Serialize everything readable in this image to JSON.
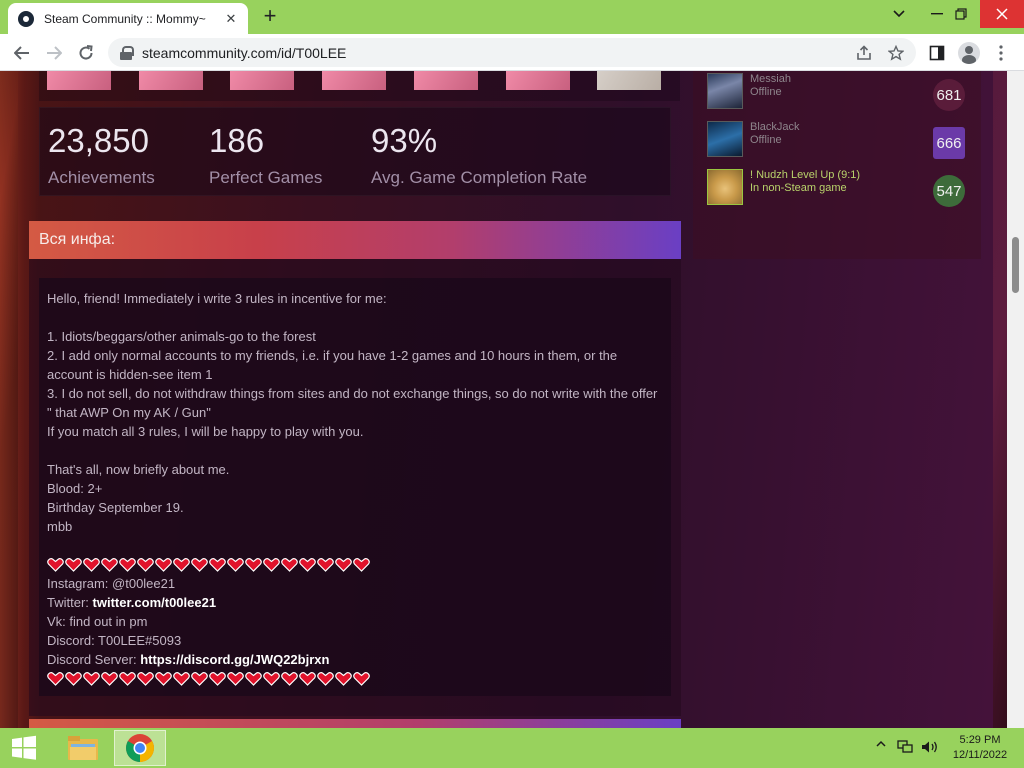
{
  "browser": {
    "tab_title": "Steam Community :: Mommy~",
    "url": "steamcommunity.com/id/T00LEE",
    "new_tab_label": "+",
    "tab_close": "✕"
  },
  "stats": [
    {
      "value": "23,850",
      "label": "Achievements"
    },
    {
      "value": "186",
      "label": "Perfect Games"
    },
    {
      "value": "93%",
      "label": "Avg. Game Completion Rate"
    }
  ],
  "info": {
    "header": "Вся инфа:",
    "lines": {
      "l1": "Hello, friend! Immediately i write 3 rules in incentive for me:",
      "l2": "1. Idiots/beggars/other animals-go to the forest",
      "l3": "2. I add only normal accounts to my friends, i.e. if you have 1-2 games and 10 hours in them, or the account is hidden-see item 1",
      "l4": "3. I do not sell, do not withdraw things from sites and do not exchange things, so do not write with the offer \" that AWP On my AK / Gun\"",
      "l5": "If you match all 3 rules, I will be happy to play with you.",
      "l6": "That's all, now briefly about me.",
      "l7": "Blood: 2+",
      "l8": "Birthday September 19.",
      "l9": "mbb",
      "instagram": "Instagram: @t00lee21",
      "twitter_prefix": "Twitter: ",
      "twitter_link": "twitter.com/t00lee21",
      "vk": "Vk: find out in pm",
      "discord": "Discord: T00LEE#5093",
      "discord_server_prefix": "Discord Server: ",
      "discord_server_link": "https://discord.gg/JWQ22bjrxn"
    },
    "heart_color": "#e0132b"
  },
  "friends": [
    {
      "name": "Messiah",
      "status": "Offline",
      "level": "681",
      "level_color": "#5a1c3a"
    },
    {
      "name": "BlackJack",
      "status": "Offline",
      "level": "666",
      "level_color": "#6b3aa8"
    },
    {
      "name": "! Nudzh Level Up (9:1)",
      "status": "In non-Steam game",
      "level": "547",
      "level_color": "#3d6b3a"
    }
  ],
  "taskbar": {
    "time": "5:29 PM",
    "date": "12/11/2022"
  },
  "colors": {
    "chrome_green": "#98d25d",
    "accent_purple": "#6a3fc4"
  }
}
